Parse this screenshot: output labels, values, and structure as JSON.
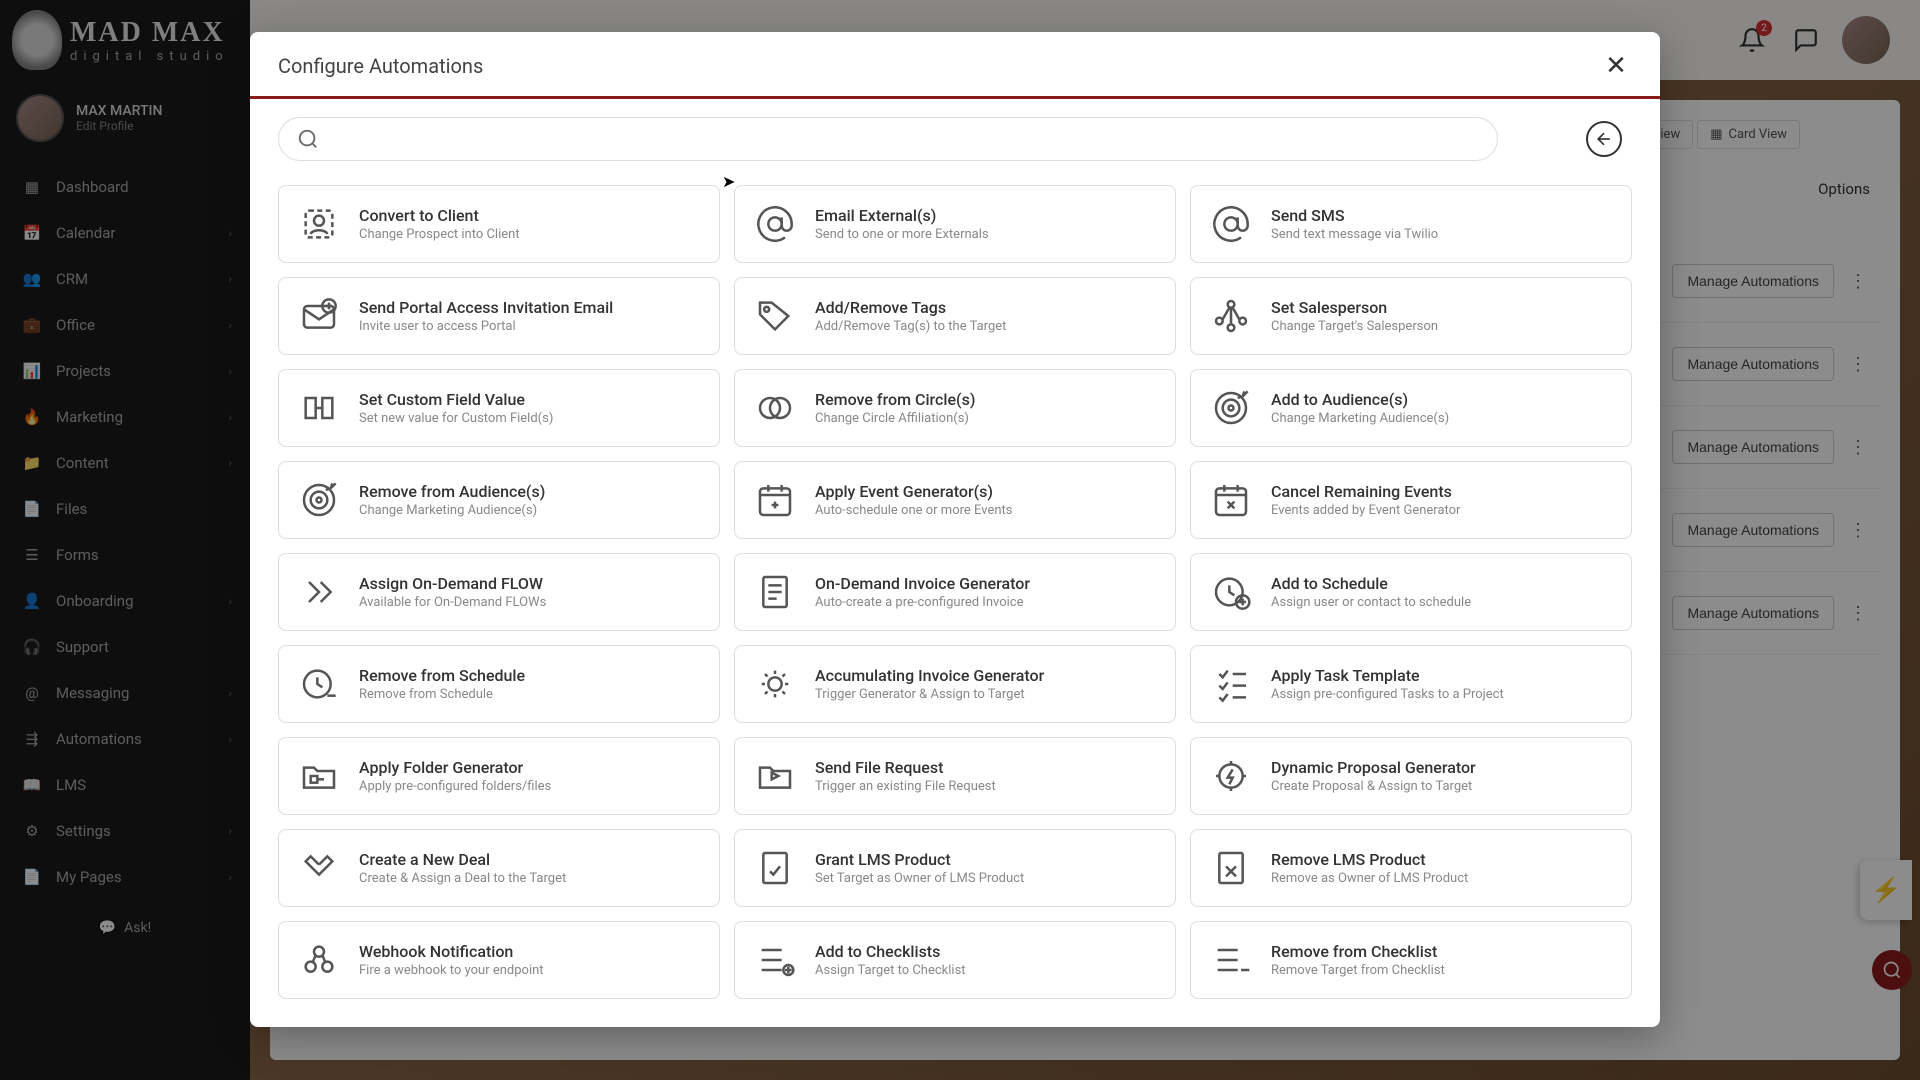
{
  "brand": {
    "main": "MAD MAX",
    "sub": "digital studio"
  },
  "profile": {
    "name": "MAX MARTIN",
    "edit": "Edit Profile"
  },
  "nav": [
    {
      "label": "Dashboard",
      "icon": "grid",
      "chevron": false
    },
    {
      "label": "Calendar",
      "icon": "calendar",
      "chevron": true
    },
    {
      "label": "CRM",
      "icon": "users",
      "chevron": true
    },
    {
      "label": "Office",
      "icon": "briefcase",
      "chevron": true
    },
    {
      "label": "Projects",
      "icon": "layers",
      "chevron": true
    },
    {
      "label": "Marketing",
      "icon": "flame",
      "chevron": true
    },
    {
      "label": "Content",
      "icon": "folder",
      "chevron": true
    },
    {
      "label": "Files",
      "icon": "file",
      "chevron": false
    },
    {
      "label": "Forms",
      "icon": "list",
      "chevron": false
    },
    {
      "label": "Onboarding",
      "icon": "user-plus",
      "chevron": true
    },
    {
      "label": "Support",
      "icon": "headset",
      "chevron": false
    },
    {
      "label": "Messaging",
      "icon": "at",
      "chevron": true
    },
    {
      "label": "Automations",
      "icon": "flow",
      "chevron": true
    },
    {
      "label": "LMS",
      "icon": "book",
      "chevron": false
    },
    {
      "label": "Settings",
      "icon": "gear",
      "chevron": true
    },
    {
      "label": "My Pages",
      "icon": "page",
      "chevron": true
    }
  ],
  "ask": "Ask!",
  "topbar": {
    "notif_count": "2"
  },
  "views": {
    "list": "List View",
    "card": "Card View",
    "options": "Options"
  },
  "bg_rows": [
    {
      "btn": "Manage Automations"
    },
    {
      "btn": "Manage Automations"
    },
    {
      "btn": "Manage Automations"
    },
    {
      "btn": "Manage Automations"
    },
    {
      "btn": "Manage Automations"
    }
  ],
  "modal": {
    "title": "Configure Automations",
    "search_placeholder": ""
  },
  "automations": [
    {
      "title": "Convert to Client",
      "desc": "Change Prospect into Client",
      "icon": "user-convert"
    },
    {
      "title": "Email External(s)",
      "desc": "Send to one or more Externals",
      "icon": "at"
    },
    {
      "title": "Send SMS",
      "desc": "Send text message via Twilio",
      "icon": "at"
    },
    {
      "title": "Send Portal Access Invitation Email",
      "desc": "Invite user to access Portal",
      "icon": "mail-plus"
    },
    {
      "title": "Add/Remove Tags",
      "desc": "Add/Remove Tag(s) to the Target",
      "icon": "tag"
    },
    {
      "title": "Set Salesperson",
      "desc": "Change Target's Salesperson",
      "icon": "network"
    },
    {
      "title": "Set Custom Field Value",
      "desc": "Set new value for Custom Field(s)",
      "icon": "slider"
    },
    {
      "title": "Remove from Circle(s)",
      "desc": "Change Circle Affiliation(s)",
      "icon": "circles"
    },
    {
      "title": "Add to Audience(s)",
      "desc": "Change Marketing Audience(s)",
      "icon": "target"
    },
    {
      "title": "Remove from Audience(s)",
      "desc": "Change Marketing Audience(s)",
      "icon": "target"
    },
    {
      "title": "Apply Event Generator(s)",
      "desc": "Auto-schedule one or more Events",
      "icon": "cal-plus"
    },
    {
      "title": "Cancel Remaining Events",
      "desc": "Events added by Event Generator",
      "icon": "cal-x"
    },
    {
      "title": "Assign On-Demand FLOW",
      "desc": "Available for On-Demand FLOWs",
      "icon": "chevrons"
    },
    {
      "title": "On-Demand Invoice Generator",
      "desc": "Auto-create a pre-configured Invoice",
      "icon": "invoice"
    },
    {
      "title": "Add to Schedule",
      "desc": "Assign user or contact to schedule",
      "icon": "clock-plus"
    },
    {
      "title": "Remove from Schedule",
      "desc": "Remove from Schedule",
      "icon": "clock-minus"
    },
    {
      "title": "Accumulating Invoice Generator",
      "desc": "Trigger Generator & Assign to Target",
      "icon": "gear-doc"
    },
    {
      "title": "Apply Task Template",
      "desc": "Assign pre-configured Tasks to a Project",
      "icon": "checklist"
    },
    {
      "title": "Apply Folder Generator",
      "desc": "Apply pre-configured folders/files",
      "icon": "folder-gen"
    },
    {
      "title": "Send File Request",
      "desc": "Trigger an existing File Request",
      "icon": "folder-send"
    },
    {
      "title": "Dynamic Proposal Generator",
      "desc": "Create Proposal & Assign to Target",
      "icon": "gear-bolt"
    },
    {
      "title": "Create a New Deal",
      "desc": "Create & Assign a Deal to the Target",
      "icon": "handshake"
    },
    {
      "title": "Grant LMS Product",
      "desc": "Set Target as Owner of LMS Product",
      "icon": "doc-check"
    },
    {
      "title": "Remove LMS Product",
      "desc": "Remove as Owner of LMS Product",
      "icon": "doc-x"
    },
    {
      "title": "Webhook Notification",
      "desc": "Fire a webhook to your endpoint",
      "icon": "webhook"
    },
    {
      "title": "Add to Checklists",
      "desc": "Assign Target to Checklist",
      "icon": "list-plus"
    },
    {
      "title": "Remove from Checklist",
      "desc": "Remove Target from Checklist",
      "icon": "list-minus"
    }
  ]
}
